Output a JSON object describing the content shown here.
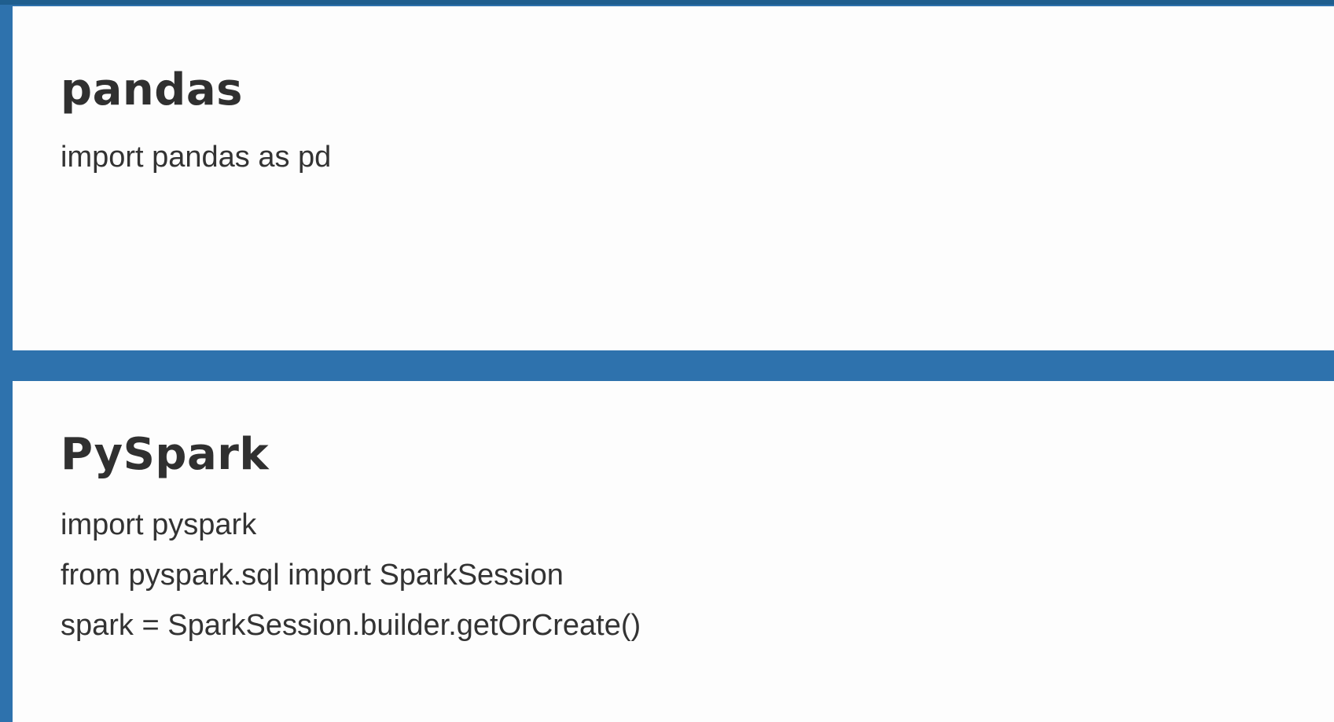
{
  "sections": [
    {
      "title": "pandas",
      "lines": [
        "import pandas as pd"
      ]
    },
    {
      "title": "PySpark",
      "lines": [
        "import pyspark",
        "from pyspark.sql import SparkSession",
        "spark = SparkSession.builder.getOrCreate()"
      ]
    }
  ],
  "colors": {
    "frame": "#2e72ad",
    "panel": "#fdfdfd",
    "text": "#333333"
  }
}
